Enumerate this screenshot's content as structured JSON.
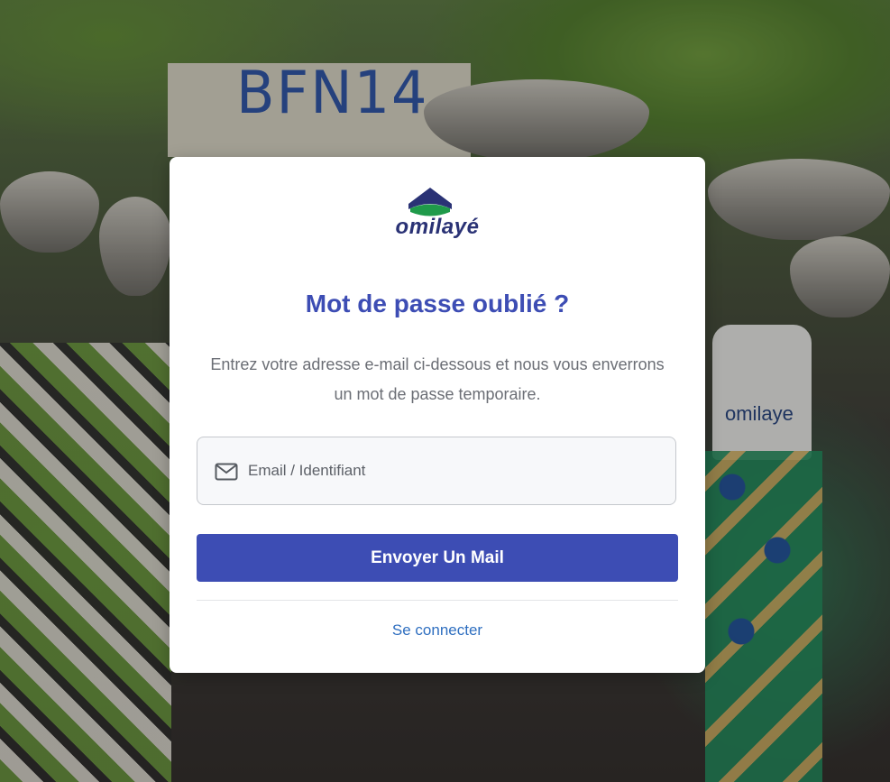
{
  "background": {
    "sign_text": "BFN14",
    "shirt_text": "omilaye"
  },
  "brand": {
    "name": "omilayé",
    "colors": {
      "logo_blue": "#2a3275",
      "logo_green": "#1f9a4a"
    }
  },
  "form": {
    "title": "Mot de passe oublié ?",
    "description": "Entrez votre adresse e-mail ci-dessous et nous vous enverrons un mot de passe temporaire.",
    "email": {
      "icon": "mail-icon",
      "placeholder": "Email / Identifiant",
      "value": ""
    },
    "submit_label": "Envoyer Un Mail",
    "login_link": "Se connecter"
  },
  "colors": {
    "primary": "#3d4db4",
    "link": "#2f6fc0",
    "text_muted": "#6b6e75",
    "input_bg": "#f7f8fa",
    "card_bg": "#ffffff"
  }
}
